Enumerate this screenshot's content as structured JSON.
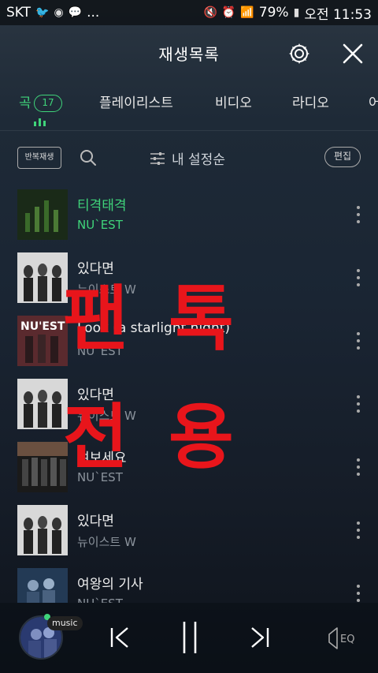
{
  "status": {
    "carrier": "SKT",
    "more": "...",
    "battery": "79%",
    "time": "오전 11:53"
  },
  "header": {
    "title": "재생목록"
  },
  "tabs": [
    {
      "label": "곡",
      "count": "17",
      "active": true
    },
    {
      "label": "플레이리스트"
    },
    {
      "label": "비디오"
    },
    {
      "label": "라디오"
    },
    {
      "label": "어"
    }
  ],
  "toolbar": {
    "repeat_label": "반복재생",
    "sort_label": "내 설정순",
    "edit_label": "편집"
  },
  "songs": [
    {
      "title": "티격태격",
      "artist": "NU`EST",
      "playing": true
    },
    {
      "title": "있다면",
      "artist": "뉴이스트 W"
    },
    {
      "title": "Look (a starlight night)",
      "artist": "NU`EST"
    },
    {
      "title": "있다면",
      "artist": "뉴이스트 W"
    },
    {
      "title": "여보세요",
      "artist": "NU`EST"
    },
    {
      "title": "있다면",
      "artist": "뉴이스트 W"
    },
    {
      "title": "여왕의 기사",
      "artist": "NU`EST"
    }
  ],
  "watermark": [
    "팬",
    "톡",
    "전",
    "용"
  ],
  "player": {
    "badge": "music"
  },
  "colors": {
    "accent": "#3fd47a",
    "watermark": "#e8151b"
  }
}
